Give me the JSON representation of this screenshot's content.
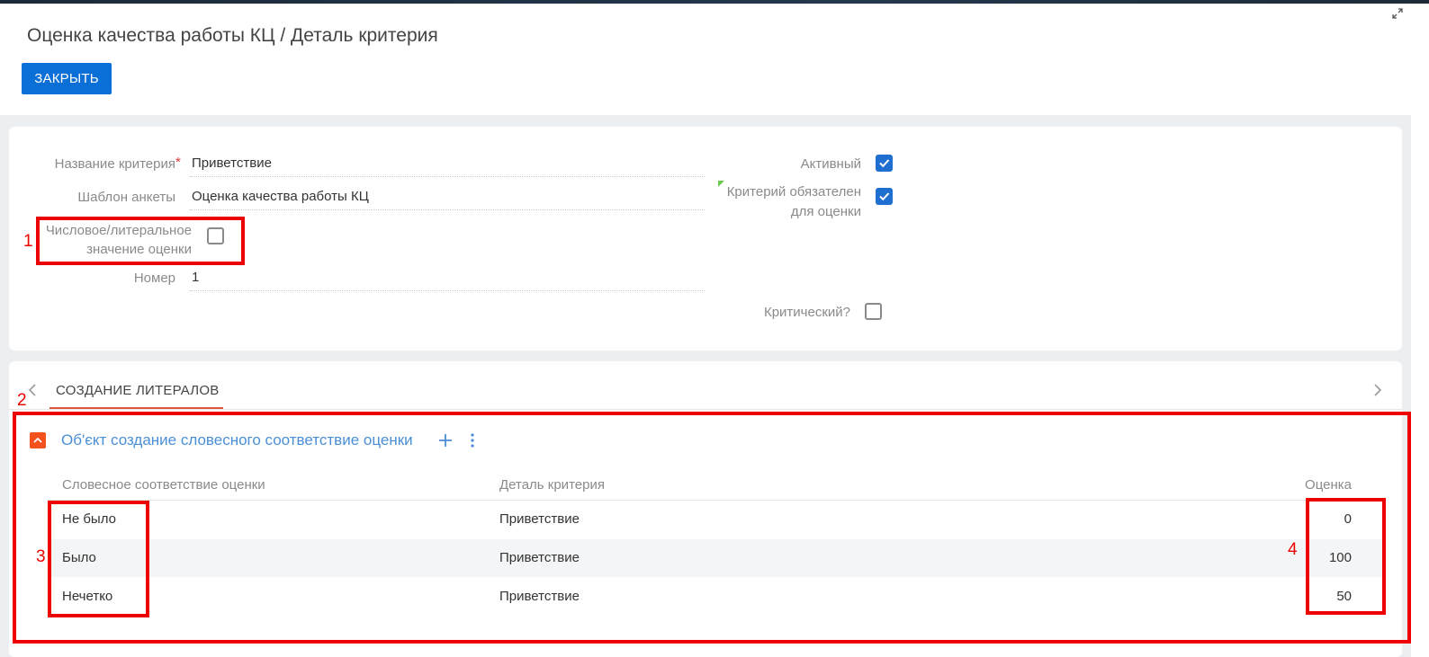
{
  "header": {
    "title": "Оценка качества работы КЦ / Деталь критерия",
    "close_label": "ЗАКРЫТЬ"
  },
  "form": {
    "name_label": "Название критерия",
    "name_required_mark": "*",
    "name_value": "Приветствие",
    "template_label": "Шаблон анкеты",
    "template_value": "Оценка качества работы КЦ",
    "numeric_label_line1": "Числовое/литеральное",
    "numeric_label_line2": "значение оценки",
    "numeric_checked": false,
    "number_label": "Номер",
    "number_value": "1",
    "active_label": "Активный",
    "active_checked": true,
    "mandatory_label_line1": "Критерий обязателен",
    "mandatory_label_line2": "для оценки",
    "mandatory_checked": true,
    "critical_label": "Критический?",
    "critical_checked": false
  },
  "tabs": {
    "items": [
      {
        "label": "СОЗДАНИЕ ЛИТЕРАЛОВ",
        "active": true
      }
    ]
  },
  "detail": {
    "title": "Об'єкт создание словесного соответствие оценки",
    "columns": {
      "verbal": "Словесное соответствие оценки",
      "criterion": "Деталь критерия",
      "score": "Оценка"
    },
    "rows": [
      {
        "verbal": "Не было",
        "criterion": "Приветствие",
        "score": "0"
      },
      {
        "verbal": "Было",
        "criterion": "Приветствие",
        "score": "100"
      },
      {
        "verbal": "Нечетко",
        "criterion": "Приветствие",
        "score": "50"
      }
    ]
  },
  "annotations": {
    "n1": "1",
    "n2": "2",
    "n3": "3",
    "n4": "4"
  },
  "colors": {
    "accent_blue": "#0a6fd6",
    "checkbox_blue": "#1f6fd1",
    "tab_underline": "#e2553a",
    "annotation_red": "#ee0000",
    "section_toggle": "#f4511e",
    "link_blue": "#4a8fd6"
  },
  "icons": {
    "expand": "expand-icon",
    "collapse": "chevron-up-icon",
    "add": "plus-icon",
    "more": "more-vertical-icon",
    "tab_prev": "chevron-left-icon",
    "tab_next": "chevron-right-icon",
    "check": "check-icon"
  }
}
